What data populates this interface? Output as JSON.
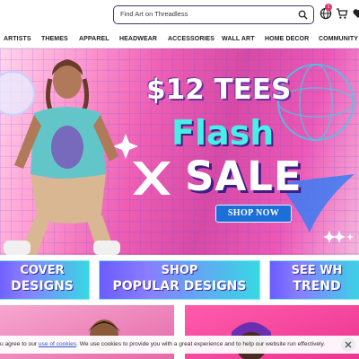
{
  "search": {
    "placeholder": "Find Art on Threadless"
  },
  "header": {
    "cart_count": "1"
  },
  "nav": {
    "items": [
      "ARTISTS",
      "THEMES",
      "APPAREL",
      "HEADWEAR",
      "ACCESSORIES",
      "WALL ART",
      "HOME DECOR",
      "COMMUNITY"
    ]
  },
  "hero": {
    "line1": "$12 TEES",
    "line2": "Flash",
    "line3": "SALE",
    "cta": "SHOP NOW"
  },
  "tiles": [
    {
      "line1": "COVER",
      "line2": "DESIGNS"
    },
    {
      "line1": "SHOP",
      "line2": "POPULAR DESIGNS"
    },
    {
      "line1": "SEE WH",
      "line2": "TREND"
    }
  ],
  "cookie": {
    "before": "u agree to our ",
    "link": "use of cookies",
    "after": ". We use cookies to provide you with a great experience and to help our website run effectively."
  },
  "colors": {
    "accent": "#1d6fd8",
    "badge": "#e0336b",
    "hero_pink": "#ee5fb4",
    "cyan": "#47f0e6"
  },
  "icons": [
    "search-icon",
    "globe-icon",
    "cart-icon",
    "heart-icon",
    "close-icon"
  ]
}
